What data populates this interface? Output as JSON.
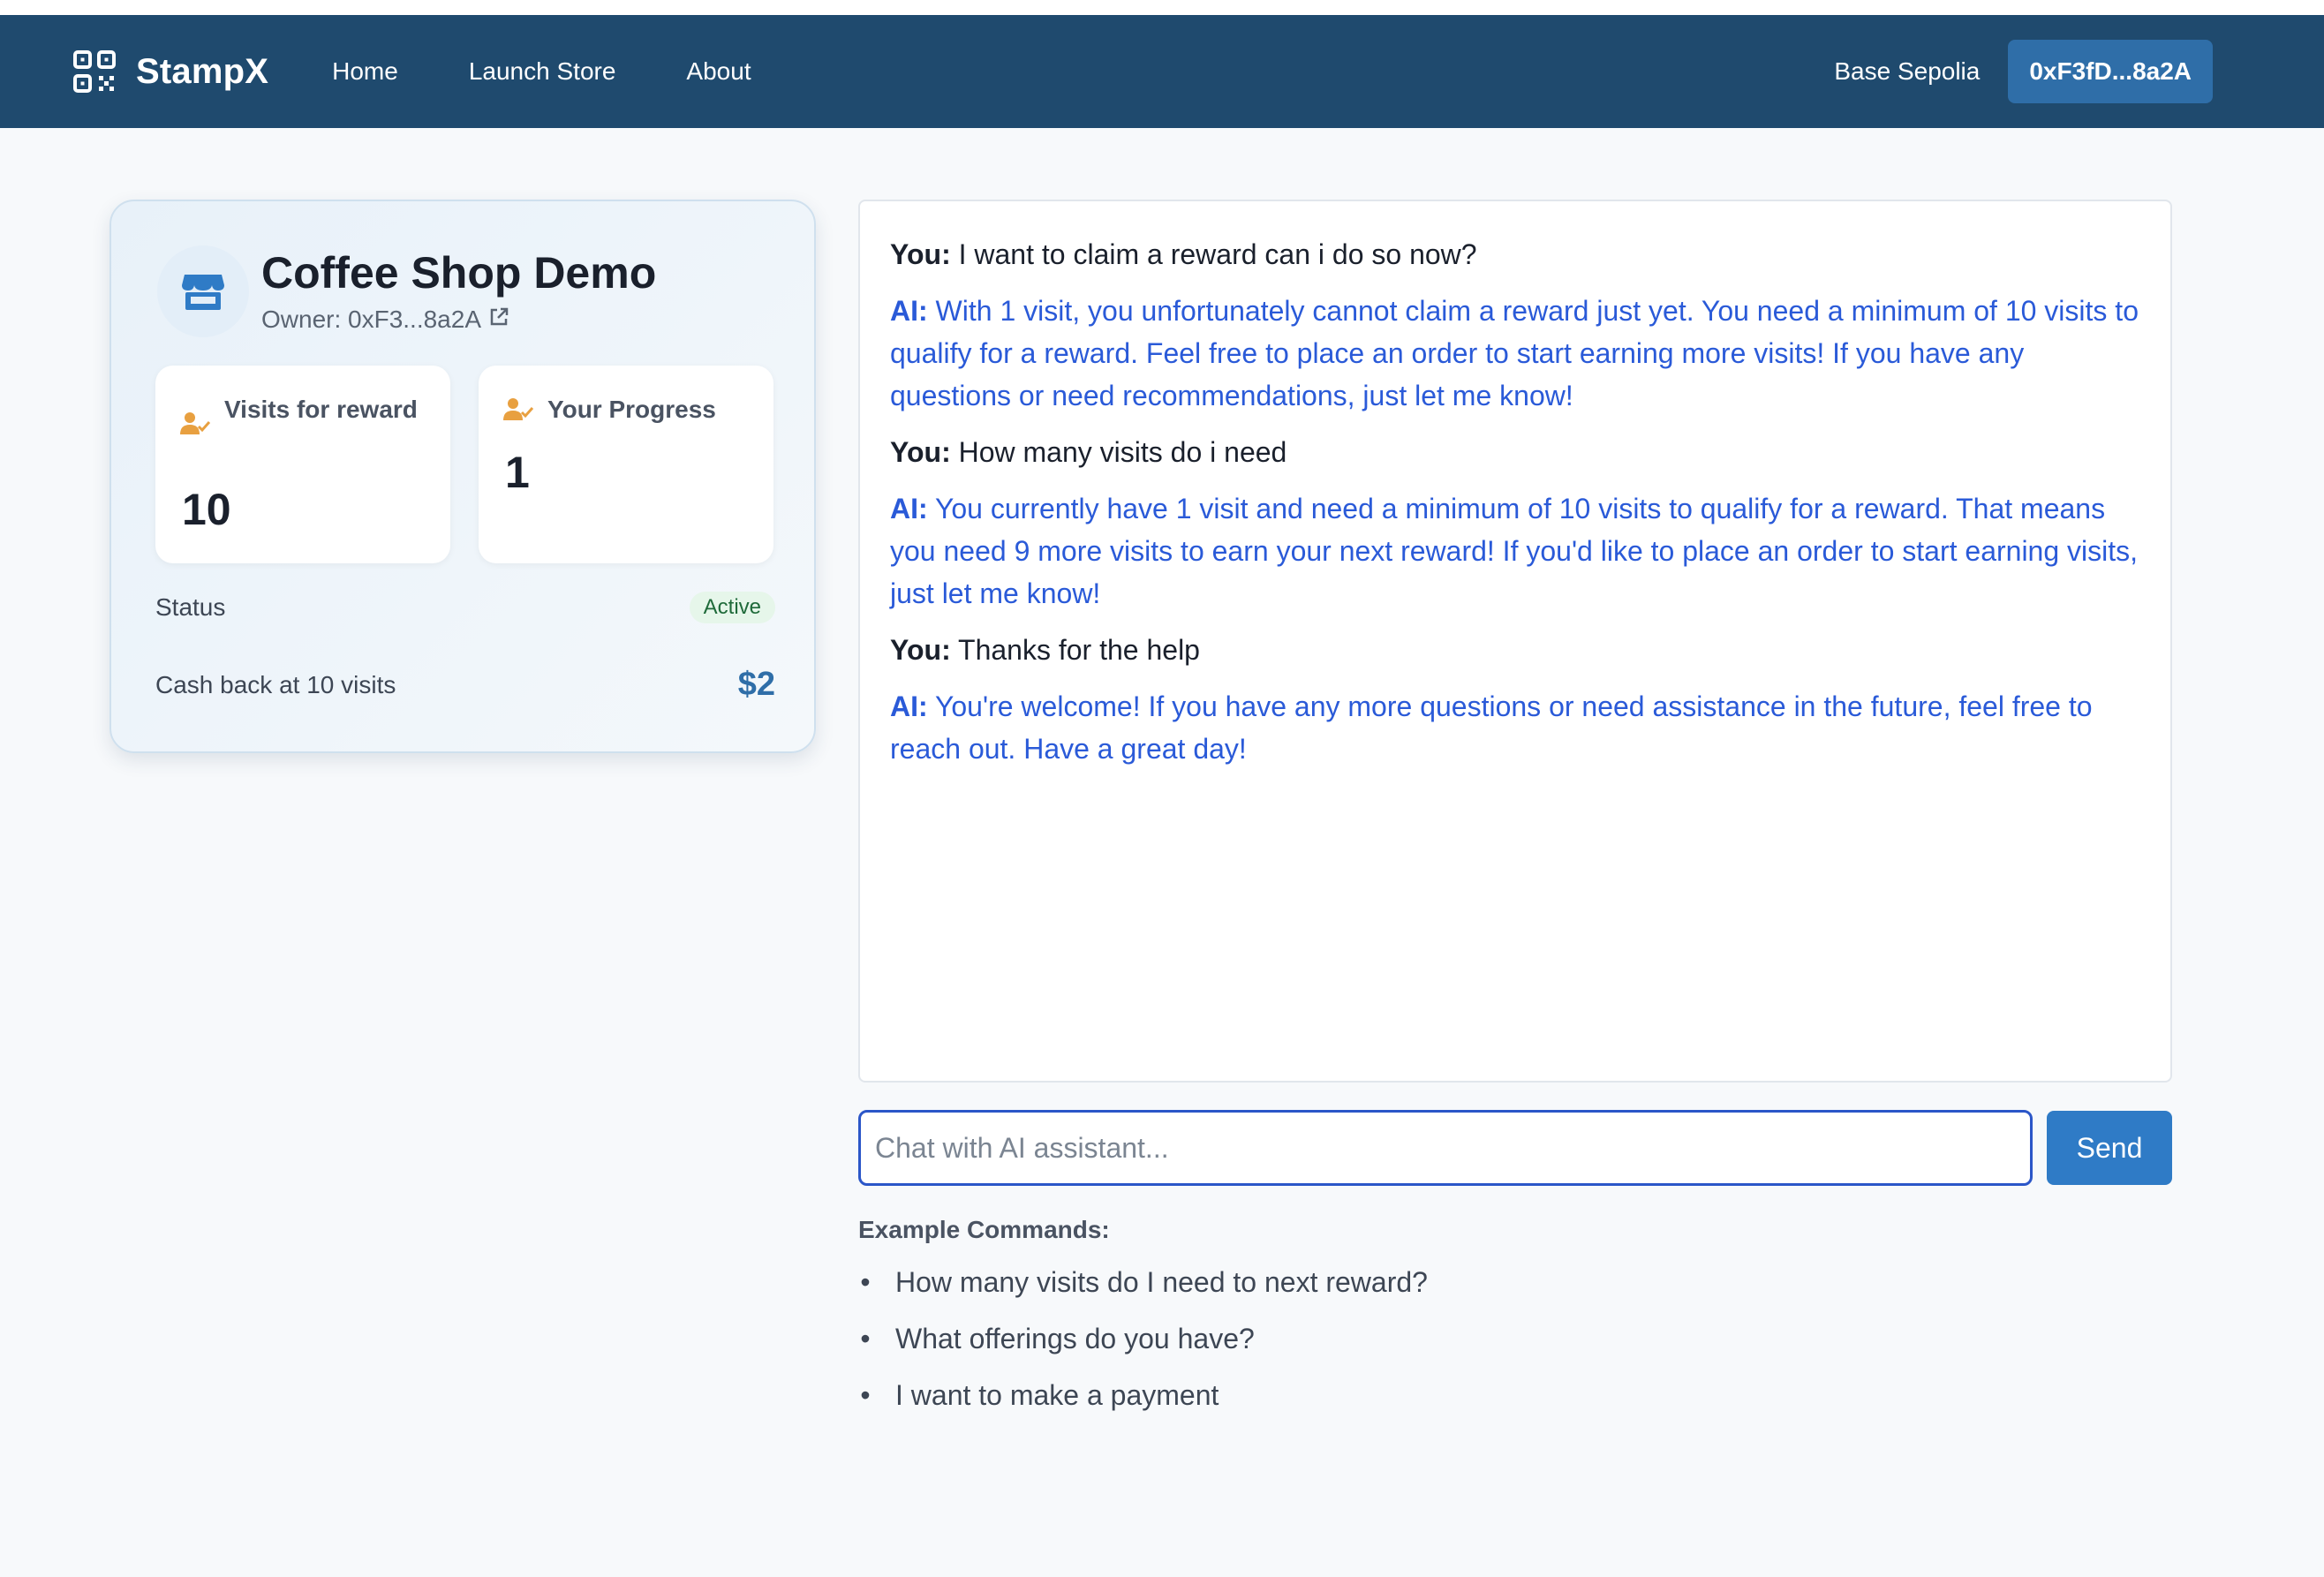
{
  "navbar": {
    "brand": "StampX",
    "links": [
      "Home",
      "Launch Store",
      "About"
    ],
    "network": "Base Sepolia",
    "wallet": "0xF3fD...8a2A"
  },
  "store": {
    "title": "Coffee Shop Demo",
    "owner": "Owner: 0xF3...8a2A",
    "visits_label": "Visits for reward",
    "visits_value": "10",
    "progress_label": "Your Progress",
    "progress_value": "1",
    "status_label": "Status",
    "status_value": "Active",
    "cashback_label": "Cash back at 10 visits",
    "cashback_value": "$2"
  },
  "chat": {
    "messages": [
      {
        "who": "You:",
        "text": "I want to claim a reward can i do so now?"
      },
      {
        "who": "AI:",
        "text": "With 1 visit, you unfortunately cannot claim a reward just yet. You need a minimum of 10 visits to qualify for a reward. Feel free to place an order to start earning more visits! If you have any questions or need recommendations, just let me know!"
      },
      {
        "who": "You:",
        "text": "How many visits do i need"
      },
      {
        "who": "AI:",
        "text": "You currently have 1 visit and need a minimum of 10 visits to qualify for a reward. That means you need 9 more visits to earn your next reward! If you'd like to place an order to start earning visits, just let me know!"
      },
      {
        "who": "You:",
        "text": "Thanks for the help"
      },
      {
        "who": "AI:",
        "text": "You're welcome! If you have any more questions or need assistance in the future, feel free to reach out. Have a great day!"
      }
    ],
    "input_placeholder": "Chat with AI assistant...",
    "send_label": "Send"
  },
  "examples": {
    "title": "Example Commands:",
    "items": [
      "How many visits do I need to next reward?",
      "What offerings do you have?",
      "I want to make a payment"
    ]
  },
  "colors": {
    "navbar": "#1f4a6e",
    "accent": "#2f7bc6",
    "ai_text": "#2a5ad8",
    "icon_orange": "#e8a040"
  }
}
